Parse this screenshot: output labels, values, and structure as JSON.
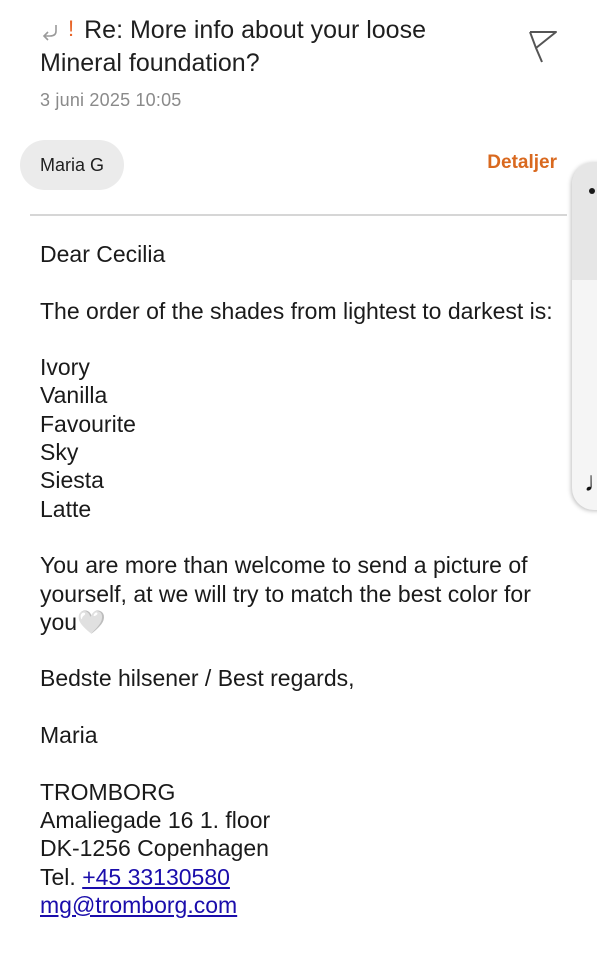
{
  "email": {
    "subject": "Re: More info about your loose Mineral foundation?",
    "important_mark": "!",
    "date": "3 juni 2025  10:05",
    "sender": "Maria G",
    "details_label": "Detaljer",
    "body": {
      "greeting": "Dear Cecilia",
      "intro": "The order of the shades from lightest to darkest is:",
      "shades": [
        "Ivory",
        "Vanilla",
        "Favourite",
        "Sky",
        "Siesta",
        "Latte"
      ],
      "paragraph": "You are more than welcome to send a picture of yourself, at we will try to match the best color for you🤍",
      "closing": "Bedste hilsener / Best regards,",
      "signature_name": "Maria",
      "company": "TROMBORG",
      "address_line1": "Amaliegade 16 1. floor",
      "address_line2": "DK-1256 Copenhagen",
      "tel_prefix": "Tel. ",
      "tel": "+45 33130580",
      "email_link": "mg@tromborg.com"
    }
  },
  "icons": {
    "reply": "reply-icon",
    "flag": "flag-icon",
    "side_panel_note": "music-note-icon"
  },
  "colors": {
    "accent": "#d9691f",
    "important": "#e8662a",
    "link": "#1a0dab",
    "chip_bg": "#ebebeb"
  }
}
